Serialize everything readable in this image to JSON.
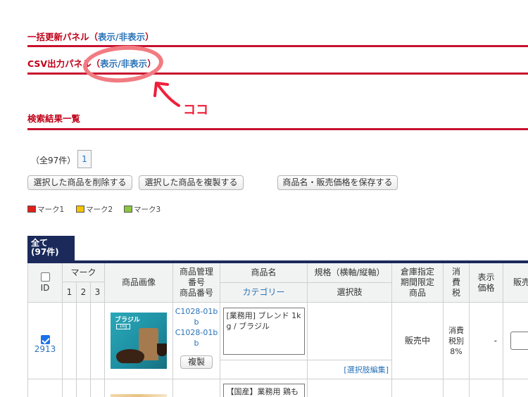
{
  "panels": {
    "bulk_update": "一括更新パネル",
    "csv_output": "CSV出力パネル",
    "toggle_label": "表示/非表示",
    "paren_open": "（",
    "paren_close": "）"
  },
  "annotation": {
    "text": "ココ",
    "color": "#f27b82"
  },
  "results": {
    "title": "検索結果一覧",
    "count_text": "（全97件）",
    "page": "1"
  },
  "buttons": {
    "delete": "選択した商品を削除する",
    "duplicate": "選択した商品を複製する",
    "save": "商品名・販売価格を保存する"
  },
  "marks": [
    {
      "label": "マーク1",
      "color": "#e0201a"
    },
    {
      "label": "マーク2",
      "color": "#f5c400"
    },
    {
      "label": "マーク3",
      "color": "#8cc63e"
    }
  ],
  "tab": {
    "line1": "全て",
    "line2": "(97件)"
  },
  "table": {
    "headers": {
      "id": "ID",
      "mark": "マーク",
      "mark_cols": [
        "1",
        "2",
        "3"
      ],
      "image": "商品画像",
      "mgmt": [
        "商品管理",
        "番号",
        "商品番号"
      ],
      "name": "商品名",
      "category": "カテゴリー",
      "spec": "規格（横軸/縦軸）",
      "option": "選択肢",
      "warehouse": [
        "倉庫指定",
        "期間限定",
        "商品"
      ],
      "tax": [
        "消",
        "費",
        "税"
      ],
      "display_price": [
        "表示",
        "価格"
      ],
      "sell": "販売"
    },
    "rows": [
      {
        "checked": true,
        "id": "2913",
        "image_label": "ブラジル",
        "image_tag": "1kg",
        "mgmt": [
          "C1028-01b",
          "b",
          "C1028-01b",
          "b"
        ],
        "copy": "複製",
        "name": [
          "[業務用] ブレンド 1k",
          "g / ブラジル"
        ],
        "option_edit": "[選択肢編集]",
        "status": "販売中",
        "tax": [
          "消費",
          "税別",
          "8%"
        ],
        "display_price": "-"
      },
      {
        "name": [
          "【国産】業務用 鶏も"
        ]
      }
    ]
  }
}
